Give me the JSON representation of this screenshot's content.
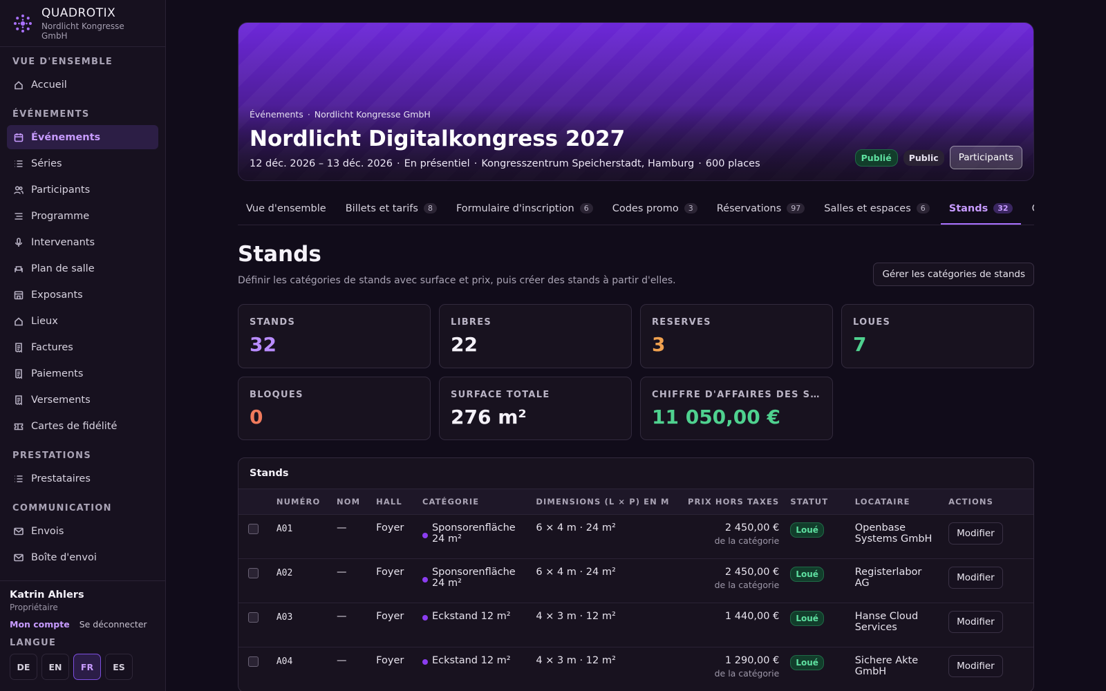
{
  "brand": {
    "name": "QUADROTIX",
    "org": "Nordlicht Kongresse GmbH"
  },
  "sidebar": {
    "sections": [
      {
        "title": "VUE D'ENSEMBLE",
        "items": [
          {
            "label": "Accueil",
            "icon": "home-icon"
          }
        ]
      },
      {
        "title": "ÉVÉNEMENTS",
        "items": [
          {
            "label": "Événements",
            "icon": "calendar-icon",
            "active": true
          },
          {
            "label": "Séries",
            "icon": "list-icon"
          },
          {
            "label": "Participants",
            "icon": "users-icon"
          },
          {
            "label": "Programme",
            "icon": "agenda-icon"
          },
          {
            "label": "Intervenants",
            "icon": "microphone-icon"
          },
          {
            "label": "Plan de salle",
            "icon": "seat-icon"
          },
          {
            "label": "Exposants",
            "icon": "store-icon"
          },
          {
            "label": "Lieux",
            "icon": "home-icon"
          },
          {
            "label": "Factures",
            "icon": "receipt-icon"
          },
          {
            "label": "Paiements",
            "icon": "receipt-icon"
          },
          {
            "label": "Versements",
            "icon": "receipt-icon"
          },
          {
            "label": "Cartes de fidélité",
            "icon": "ticket-icon"
          }
        ]
      },
      {
        "title": "PRESTATIONS",
        "items": [
          {
            "label": "Prestataires",
            "icon": "list-icon"
          }
        ]
      },
      {
        "title": "COMMUNICATION",
        "items": [
          {
            "label": "Envois",
            "icon": "mail-icon"
          },
          {
            "label": "Boîte d'envoi",
            "icon": "mail-icon"
          }
        ]
      }
    ]
  },
  "user": {
    "name": "Katrin Ahlers",
    "role": "Propriétaire",
    "account": "Mon compte",
    "logout": "Se déconnecter"
  },
  "language": {
    "label": "LANGUE",
    "options": [
      "DE",
      "EN",
      "FR",
      "ES"
    ],
    "active": "FR"
  },
  "event": {
    "breadcrumb": [
      "Événements",
      "Nordlicht Kongresse GmbH"
    ],
    "title": "Nordlicht Digitalkongress 2027",
    "meta": [
      "12 déc. 2026 – 13 déc. 2026",
      "En présentiel",
      "Kongresszentrum Speicherstadt, Hamburg",
      "600 places"
    ],
    "status": "Publié",
    "visibility": "Public",
    "participants_button": "Participants"
  },
  "tabs": [
    {
      "label": "Vue d'ensemble",
      "count": ""
    },
    {
      "label": "Billets et tarifs",
      "count": "8"
    },
    {
      "label": "Formulaire d'inscription",
      "count": "6"
    },
    {
      "label": "Codes promo",
      "count": "3"
    },
    {
      "label": "Réservations",
      "count": "97"
    },
    {
      "label": "Salles et espaces",
      "count": "6"
    },
    {
      "label": "Stands",
      "count": "32",
      "active": true
    },
    {
      "label": "Objet",
      "count": ""
    }
  ],
  "page": {
    "title": "Stands",
    "description": "Définir les catégories de stands avec surface et prix, puis créer des stands à partir d'elles.",
    "manage_button": "Gérer les catégories de stands"
  },
  "stats": [
    {
      "label": "STANDS",
      "value": "32",
      "color": "#b98cff"
    },
    {
      "label": "LIBRES",
      "value": "22",
      "color": "#f4f1f8"
    },
    {
      "label": "RÉSERVÉS",
      "value": "3",
      "color": "#f0a14f"
    },
    {
      "label": "LOUÉS",
      "value": "7",
      "color": "#4fd18f"
    },
    {
      "label": "BLOQUÉS",
      "value": "0",
      "color": "#f07a5c"
    },
    {
      "label": "SURFACE TOTALE",
      "value": "276 m²",
      "color": "#f4f1f8"
    },
    {
      "label": "CHIFFRE D'AFFAIRES DES STANDS",
      "value": "11 050,00 €",
      "color": "#4fd18f"
    }
  ],
  "table": {
    "title": "Stands",
    "columns": [
      "NUMÉRO",
      "NOM",
      "HALL",
      "CATÉGORIE",
      "DIMENSIONS (L × P) EN M",
      "PRIX HORS TAXES",
      "STATUT",
      "LOCATAIRE",
      "ACTIONS"
    ],
    "rows": [
      {
        "number": "A01",
        "name": "—",
        "hall": "Foyer",
        "category": "Sponsorenfläche 24 m²",
        "dimensions": "6 × 4 m · 24 m²",
        "price": "2 450,00 €",
        "price_note": "de la catégorie",
        "status": "Loué",
        "tenant": "Openbase Systems GmbH",
        "action": "Modifier"
      },
      {
        "number": "A02",
        "name": "—",
        "hall": "Foyer",
        "category": "Sponsorenfläche 24 m²",
        "dimensions": "6 × 4 m · 24 m²",
        "price": "2 450,00 €",
        "price_note": "de la catégorie",
        "status": "Loué",
        "tenant": "Registerlabor AG",
        "action": "Modifier"
      },
      {
        "number": "A03",
        "name": "—",
        "hall": "Foyer",
        "category": "Eckstand 12 m²",
        "dimensions": "4 × 3 m · 12 m²",
        "price": "1 440,00 €",
        "price_note": "",
        "status": "Loué",
        "tenant": "Hanse Cloud Services",
        "action": "Modifier"
      },
      {
        "number": "A04",
        "name": "—",
        "hall": "Foyer",
        "category": "Eckstand 12 m²",
        "dimensions": "4 × 3 m · 12 m²",
        "price": "1 290,00 €",
        "price_note": "de la catégorie",
        "status": "Loué",
        "tenant": "Sichere Akte GmbH",
        "action": "Modifier"
      }
    ]
  }
}
